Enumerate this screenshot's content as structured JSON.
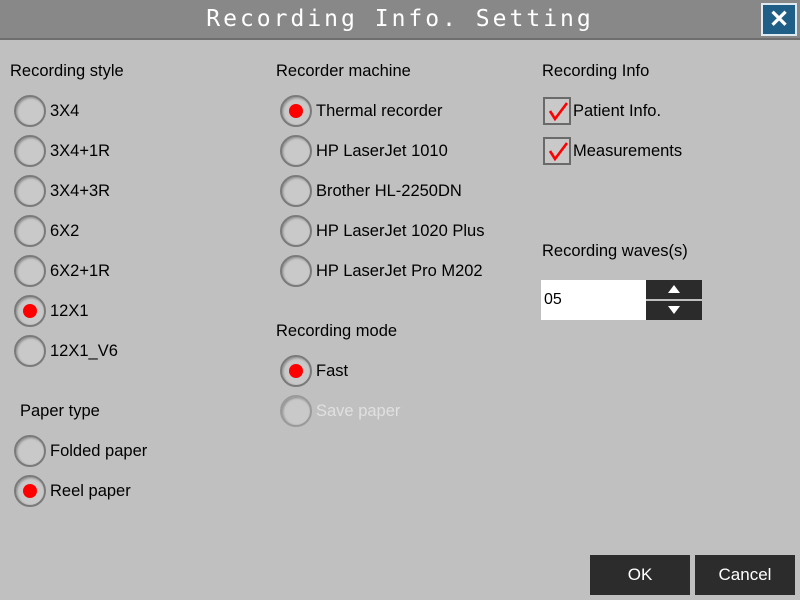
{
  "window": {
    "title": "Recording Info. Setting",
    "close_icon": "close-icon"
  },
  "recording_style": {
    "heading": "Recording style",
    "options": [
      "3X4",
      "3X4+1R",
      "3X4+3R",
      "6X2",
      "6X2+1R",
      "12X1",
      "12X1_V6"
    ],
    "selected": "12X1"
  },
  "paper_type": {
    "heading": "Paper type",
    "options": [
      "Folded paper",
      "Reel paper"
    ],
    "selected": "Reel paper"
  },
  "recorder_machine": {
    "heading": "Recorder machine",
    "options": [
      "Thermal recorder",
      "HP LaserJet 1010",
      "Brother HL-2250DN",
      "HP LaserJet 1020 Plus",
      "HP LaserJet Pro M202"
    ],
    "selected": "Thermal recorder"
  },
  "recording_mode": {
    "heading": "Recording mode",
    "options": [
      "Fast",
      "Save paper"
    ],
    "selected": "Fast",
    "disabled": [
      "Save paper"
    ]
  },
  "recording_info": {
    "heading": "Recording Info",
    "patient_info": {
      "label": "Patient Info.",
      "checked": true
    },
    "measurements": {
      "label": "Measurements",
      "checked": true
    }
  },
  "recording_waves": {
    "heading": "Recording waves(s)",
    "value": "05",
    "up_icon": "triangle-up-icon",
    "down_icon": "triangle-down-icon"
  },
  "footer": {
    "ok_label": "OK",
    "cancel_label": "Cancel"
  },
  "colors": {
    "background": "#c0c0c0",
    "titlebar": "#888888",
    "close_button": "#1f5f87",
    "radio_selected": "#ff0000",
    "checkmark": "#ff0000",
    "footer_button": "#2c2c2c"
  }
}
